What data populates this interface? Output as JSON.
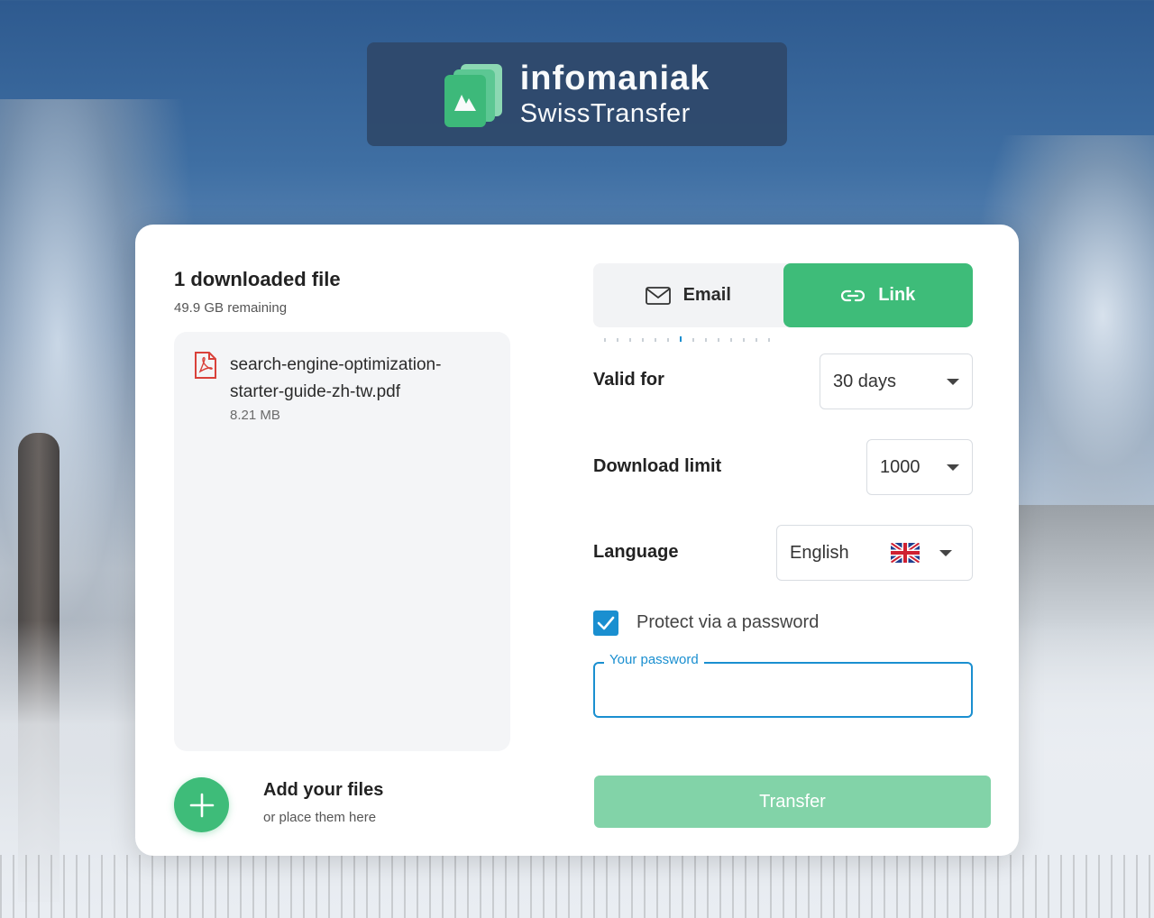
{
  "brand": {
    "name": "infomaniak",
    "product": "SwissTransfer"
  },
  "files": {
    "title": "1 downloaded file",
    "remaining": "49.9 GB remaining",
    "items": [
      {
        "name": "search-engine-optimization-starter-guide-zh-tw.pdf",
        "size": "8.21 MB",
        "icon": "pdf-file-icon"
      }
    ],
    "add_title": "Add your files",
    "add_subtitle": "or place them here"
  },
  "tabs": {
    "email_label": "Email",
    "link_label": "Link",
    "active": "Link"
  },
  "settings": {
    "valid_for_label": "Valid for",
    "valid_for_value": "30 days",
    "download_limit_label": "Download limit",
    "download_limit_value": "1000",
    "language_label": "Language",
    "language_value": "English",
    "password_checkbox_label": "Protect via a password",
    "password_checked": true,
    "password_field_label": "Your password",
    "password_value": ""
  },
  "transfer_label": "Transfer",
  "colors": {
    "brand_green": "#3ebc79",
    "transfer_disabled": "#82d3a8",
    "accent_blue": "#1a8fd0",
    "brand_box": "#2f4a6d"
  }
}
